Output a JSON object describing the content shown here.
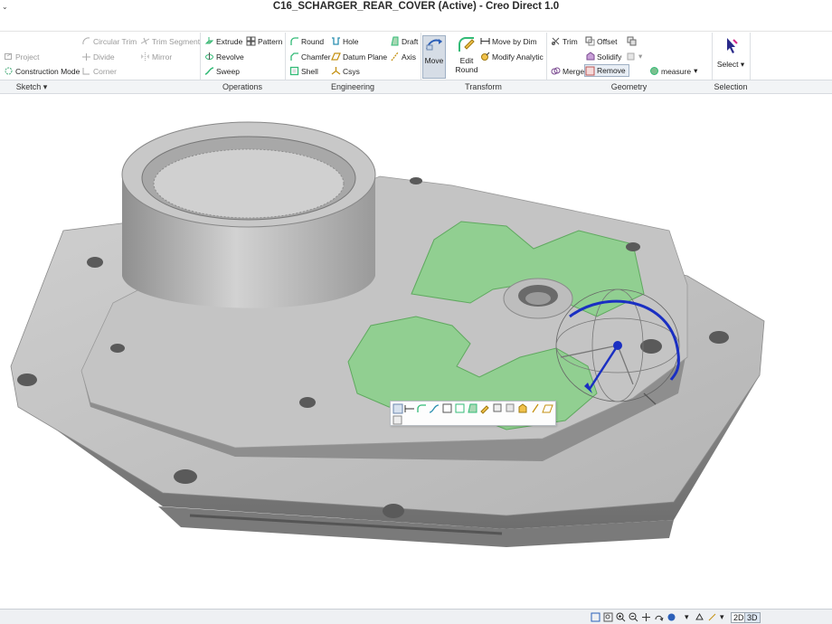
{
  "window": {
    "title": "C16_SCHARGER_REAR_COVER (Active) - Creo Direct 1.0",
    "corner_glyph": "⌄"
  },
  "ribbon": {
    "sketch": {
      "label": "Sketch",
      "project": "Project",
      "construction_mode": "Construction Mode",
      "circular_trim": "Circular Trim",
      "trim_segment": "Trim Segment",
      "divide": "Divide",
      "mirror": "Mirror",
      "corner": "Corner"
    },
    "operations": {
      "label": "Operations",
      "extrude": "Extrude",
      "pattern": "Pattern",
      "revolve": "Revolve",
      "sweep": "Sweep"
    },
    "engineering": {
      "label": "Engineering",
      "round": "Round",
      "hole": "Hole",
      "draft": "Draft",
      "chamfer": "Chamfer",
      "datum_plane": "Datum Plane",
      "axis": "Axis",
      "shell": "Shell",
      "csys": "Csys"
    },
    "transform": {
      "label": "Transform",
      "move": "Move",
      "edit_round_line1": "Edit",
      "edit_round_line2": "Round",
      "move_by_dim": "Move by Dim",
      "modify_analytic": "Modify Analytic"
    },
    "geometry": {
      "label": "Geometry",
      "trim": "Trim",
      "offset": "Offset",
      "solidify": "Solidify",
      "merge": "Merge",
      "remove": "Remove",
      "measure": "measure"
    },
    "selection": {
      "label": "Selection",
      "select": "Select"
    }
  },
  "statusbar": {
    "view_2d": "2D",
    "view_3d": "3D"
  },
  "colors": {
    "part_gray": "#b9b9b9",
    "selected_green": "#8fd08f",
    "dragger_blue": "#1a2fc2",
    "ribbon_label_bg": "#f2f4f6"
  },
  "icons": [
    "project-icon",
    "construction-mode-icon",
    "circular-trim-icon",
    "trim-segment-icon",
    "divide-icon",
    "mirror-icon",
    "corner-icon",
    "extrude-icon",
    "pattern-icon",
    "revolve-icon",
    "sweep-icon",
    "round-icon",
    "hole-icon",
    "draft-icon",
    "chamfer-icon",
    "datum-plane-icon",
    "axis-icon",
    "shell-icon",
    "csys-icon",
    "move-icon",
    "edit-round-icon",
    "move-by-dim-icon",
    "modify-analytic-icon",
    "trim-icon",
    "offset-icon",
    "solidify-icon",
    "merge-icon",
    "remove-icon",
    "measure-icon",
    "select-icon"
  ]
}
